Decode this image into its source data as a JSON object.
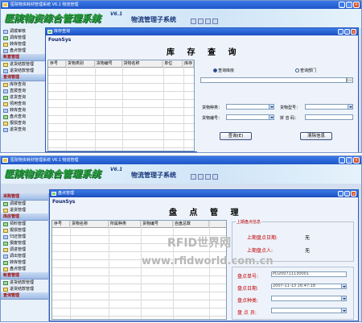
{
  "screenA": {
    "app_title": "医院物资耗材管理系统 V6.1  物流管理",
    "logo": "医院物资综合管理系统",
    "version": "V6.1",
    "subsystem": "物流管理子系统",
    "sidebar": [
      {
        "label": "调拨审核",
        "type": "item"
      },
      {
        "label": "调库管理",
        "type": "item"
      },
      {
        "label": "转库管理",
        "type": "item"
      },
      {
        "label": "盘点管理",
        "type": "item"
      },
      {
        "label": "帐套管理",
        "type": "header"
      },
      {
        "label": "进货结款管理",
        "type": "item"
      },
      {
        "label": "退货结款管理",
        "type": "item"
      },
      {
        "label": "查询管理",
        "type": "header"
      },
      {
        "label": "库存查询",
        "type": "item"
      },
      {
        "label": "直拨查询",
        "type": "item"
      },
      {
        "label": "进货查询",
        "type": "item"
      },
      {
        "label": "领用查询",
        "type": "item"
      },
      {
        "label": "转库查询",
        "type": "item"
      },
      {
        "label": "盘点查询",
        "type": "item"
      },
      {
        "label": "报损查询",
        "type": "item"
      },
      {
        "label": "退货查询",
        "type": "item"
      }
    ],
    "window": {
      "title": "库存查询",
      "brand": "FounSys",
      "heading": "库 存 查 询",
      "columns": [
        "序号",
        "货物类别",
        "货物编号",
        "货物名称",
        "单位",
        "库存"
      ],
      "radio_warehouse": "查询库房",
      "radio_dept": "查询部门",
      "label_category": "货物种类：",
      "label_model": "货物型号：",
      "label_code": "货物编号：",
      "label_pinyin": "拼 音 码：",
      "dots": "...",
      "btn_query": "查询(E)",
      "btn_clear": "清除信息"
    }
  },
  "screenB": {
    "app_title": "医院物资耗材管理系统 V6.1  物流管理",
    "logo": "医院物资综合管理系统",
    "version": "V6.1",
    "subsystem": "物流管理子系统",
    "sidebar": [
      {
        "label": "采购管理",
        "type": "header"
      },
      {
        "label": "调拨管理",
        "type": "item"
      },
      {
        "label": "退货管理",
        "type": "item"
      },
      {
        "label": "库房管理",
        "type": "header"
      },
      {
        "label": "领料管理",
        "type": "item"
      },
      {
        "label": "报损管理",
        "type": "item"
      },
      {
        "label": "归还管理",
        "type": "item"
      },
      {
        "label": "报废管理",
        "type": "item"
      },
      {
        "label": "调进管理",
        "type": "item"
      },
      {
        "label": "调出管理",
        "type": "item"
      },
      {
        "label": "转库管理",
        "type": "item"
      },
      {
        "label": "盘点管理",
        "type": "item"
      },
      {
        "label": "帐套管理",
        "type": "header"
      },
      {
        "label": "进货结款管理",
        "type": "item"
      },
      {
        "label": "退货结款管理",
        "type": "item"
      },
      {
        "label": "查询管理",
        "type": "header"
      }
    ],
    "window": {
      "title": "盘点管理",
      "brand": "FounSys",
      "heading": "盘 点 管 理",
      "columns": [
        "序号",
        "货物名称",
        "所属种类",
        "货物编号",
        "自盘总数"
      ],
      "last_group": "上期盘点信息",
      "last_date_label": "上期盘点日期:",
      "last_date_value": "无",
      "last_person_label": "上期盘点人:",
      "last_person_value": "无",
      "no_label": "盘点单号:",
      "no_value": "PD200711130001",
      "date_label": "盘点日期:",
      "date_value": "2007-11-13 16:47:18",
      "kind_label": "盘点种类:",
      "staff_label": "盘 点 员:"
    }
  },
  "watermark": {
    "line1": "RFID世界网",
    "line2": "www.rfidworld.com.cn"
  }
}
